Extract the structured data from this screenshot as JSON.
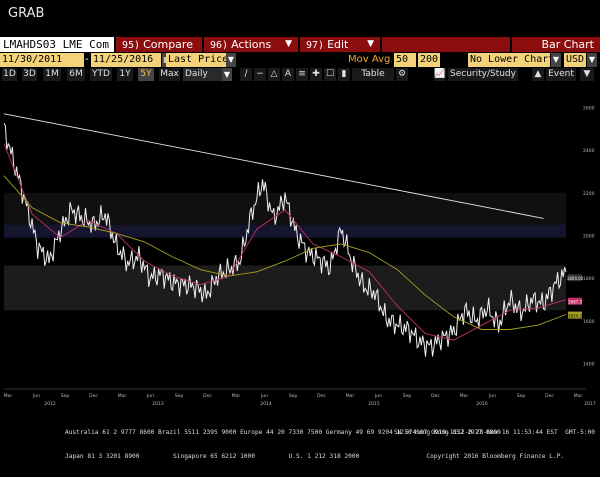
{
  "window": {
    "title": "GRAB"
  },
  "toolbar": {
    "ticker": "LMAHDS03 LME Com",
    "compare": {
      "num": "95)",
      "label": "Compare"
    },
    "actions": {
      "num": "96)",
      "label": "Actions"
    },
    "edit": {
      "num": "97)",
      "label": "Edit"
    },
    "chart_type": "Bar Chart"
  },
  "params": {
    "start_date": "11/30/2011",
    "end_date": "11/25/2016",
    "price_type": "Last Price",
    "study_label": "Mov Avg",
    "mov_avg_1": "50",
    "mov_avg_2": "200",
    "lower_chart": "No Lower Chart",
    "currency": "USD"
  },
  "range_tabs": [
    "1D",
    "3D",
    "1M",
    "6M",
    "YTD",
    "1Y",
    "5Y",
    "Max"
  ],
  "range_active": "5Y",
  "frequency": "Daily",
  "tools": {
    "table": "Table",
    "security_study": "Security/Study",
    "event": "Event"
  },
  "chart_data": {
    "type": "line",
    "title": "",
    "x_tick_labels": [
      "Mar",
      "Jun",
      "Sep",
      "Dec",
      "Mar",
      "Jun",
      "Sep",
      "Dec",
      "Mar",
      "Jun",
      "Sep",
      "Dec",
      "Mar",
      "Jun",
      "Sep",
      "Dec",
      "Mar",
      "Jun",
      "Sep",
      "Dec",
      "Mar"
    ],
    "x_year_labels": [
      "2012",
      "2013",
      "2014",
      "2015",
      "2016",
      "2017"
    ],
    "y_tick_labels": [
      "2600",
      "2400",
      "2200",
      "2000",
      "1800",
      "1600",
      "1400"
    ],
    "ylim": [
      1300,
      2700
    ],
    "grid": "horizontal bands",
    "last_value_labels": [
      "1804.00",
      "1687.3",
      "1624.3"
    ],
    "series": [
      {
        "name": "",
        "color": "#f0f0f0",
        "x": [
          0,
          0.02,
          0.04,
          0.06,
          0.08,
          0.1,
          0.12,
          0.14,
          0.16,
          0.18,
          0.2,
          0.22,
          0.24,
          0.26,
          0.28,
          0.3,
          0.32,
          0.34,
          0.36,
          0.38,
          0.4,
          0.42,
          0.44,
          0.46,
          0.48,
          0.5,
          0.52,
          0.54,
          0.56,
          0.58,
          0.6,
          0.62,
          0.64,
          0.66,
          0.68,
          0.7,
          0.72,
          0.74,
          0.76,
          0.78,
          0.8,
          0.82,
          0.84,
          0.86,
          0.88,
          0.9,
          0.92,
          0.94,
          0.96,
          0.98,
          1.0
        ],
        "y": [
          2500,
          2320,
          2140,
          1950,
          1880,
          2020,
          2120,
          2080,
          2050,
          2100,
          1950,
          1870,
          1900,
          1800,
          1820,
          1780,
          1770,
          1760,
          1720,
          1810,
          1840,
          1880,
          2100,
          2250,
          2080,
          2180,
          2010,
          1920,
          1890,
          1850,
          2030,
          1870,
          1760,
          1730,
          1610,
          1580,
          1560,
          1500,
          1480,
          1520,
          1550,
          1650,
          1600,
          1660,
          1580,
          1700,
          1640,
          1700,
          1680,
          1770,
          1830
        ]
      },
      {
        "name": "",
        "color": "#c0306a",
        "x": [
          0,
          0.05,
          0.1,
          0.15,
          0.2,
          0.25,
          0.3,
          0.35,
          0.4,
          0.45,
          0.5,
          0.55,
          0.6,
          0.65,
          0.7,
          0.75,
          0.8,
          0.85,
          0.9,
          0.95,
          1.0
        ],
        "y": [
          2430,
          2100,
          1990,
          2070,
          2010,
          1880,
          1810,
          1770,
          1810,
          2030,
          2120,
          1960,
          1900,
          1830,
          1670,
          1540,
          1510,
          1580,
          1650,
          1660,
          1700
        ]
      },
      {
        "name": "",
        "color": "#a8a020",
        "x": [
          0,
          0.05,
          0.1,
          0.15,
          0.2,
          0.25,
          0.3,
          0.35,
          0.4,
          0.45,
          0.5,
          0.55,
          0.6,
          0.65,
          0.7,
          0.75,
          0.8,
          0.85,
          0.9,
          0.95,
          1.0
        ],
        "y": [
          2280,
          2130,
          2060,
          2040,
          2010,
          1970,
          1900,
          1840,
          1810,
          1830,
          1880,
          1940,
          1960,
          1920,
          1840,
          1720,
          1620,
          1560,
          1560,
          1580,
          1630
        ]
      },
      {
        "name": "",
        "color": "#e6e6e6",
        "style": "trendline",
        "x": [
          0,
          0.96
        ],
        "y": [
          2570,
          2080
        ]
      }
    ]
  },
  "footer": {
    "line1": "Australia 61 2 9777 8600 Brazil 5511 2395 9000 Europe 44 20 7330 7500 Germany 49 69 9204 1210 Hong Kong 852 2977 6000",
    "line2": "Japan 81 3 3201 8900         Singapore 65 6212 1000         U.S. 1 212 318 2000                  Copyright 2016 Bloomberg Finance L.P.",
    "line3": "SN 574107 G919-1112-0 28-Nov-16 11:53:44 EST  GMT-5:00"
  }
}
